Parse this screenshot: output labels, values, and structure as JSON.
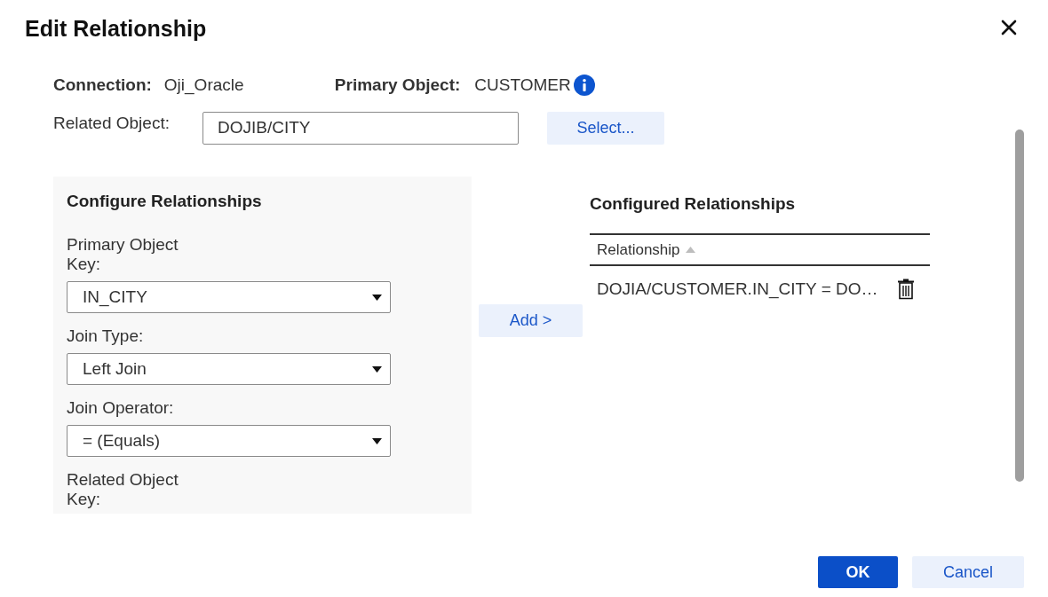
{
  "dialog": {
    "title": "Edit Relationship"
  },
  "summary": {
    "connection_label": "Connection:",
    "connection_value": "Oji_Oracle",
    "primary_label": "Primary Object:",
    "primary_value": "CUSTOMER"
  },
  "related_object": {
    "label": "Related Object:",
    "value": "DOJIB/CITY",
    "button": "Select..."
  },
  "configure": {
    "title": "Configure Relationships",
    "fields": [
      {
        "kind": "select",
        "label": "Primary Object Key:",
        "value": "IN_CITY"
      },
      {
        "kind": "select",
        "label": "Join Type:",
        "value": "Left Join"
      },
      {
        "kind": "select",
        "label": "Join Operator:",
        "value": "= (Equals)"
      },
      {
        "kind": "label",
        "label": "Related Object Key:"
      }
    ]
  },
  "add_button": "Add >",
  "configured": {
    "title": "Configured Relationships",
    "columns": [
      {
        "label": "Relationship",
        "sorted": true
      }
    ],
    "rows": [
      {
        "relationship": "DOJIA/CUSTOMER.IN_CITY = DO…"
      }
    ]
  },
  "buttons": [
    {
      "label": "OK",
      "kind": "primary"
    },
    {
      "label": "Cancel",
      "kind": "secondary"
    }
  ]
}
